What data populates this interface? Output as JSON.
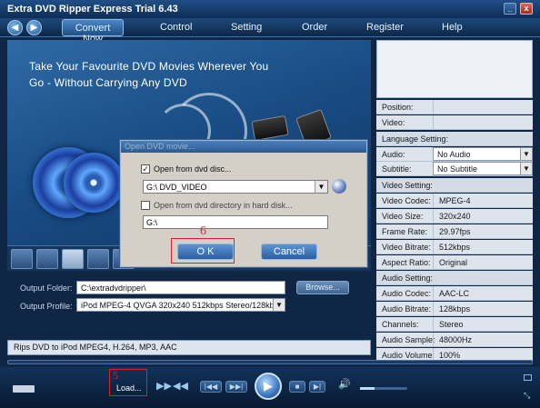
{
  "window": {
    "title": "Extra DVD Ripper Express Trial 6.43",
    "minimize": "_",
    "close": "x"
  },
  "menu": {
    "back": "◀",
    "forward": "▶",
    "items": [
      "Convert Now",
      "Control",
      "Setting",
      "Order",
      "Register",
      "Help"
    ]
  },
  "banner": {
    "line1": "Take Your Favourite DVD Movies Wherever  You",
    "line2": "Go - Without Carrying Any DVD"
  },
  "dialog": {
    "title": "Open DVD movie...",
    "option_disc": {
      "label": "Open from dvd disc...",
      "checked": true,
      "mark": "✓"
    },
    "disc_select": {
      "value": "G:\\ DVD_VIDEO",
      "arrow": "▼"
    },
    "option_dir": {
      "label": "Open from dvd directory in hard disk...",
      "checked": false
    },
    "dir_path": "G:\\",
    "ok_label": "O K",
    "cancel_label": "Cancel",
    "annotation_step": "6"
  },
  "output": {
    "folder_label": "Output Folder:",
    "folder_value": "C:\\extradvdripper\\",
    "browse_label": "Browse...",
    "profile_label": "Output Profile:",
    "profile_value": "iPod  MPEG-4 QVGA 320x240 512kbps  Stereo/128kbps",
    "profile_arrow": "▼"
  },
  "status": {
    "text": "Rips DVD to iPod MPEG4, H.264, MP3, AAC"
  },
  "properties": {
    "rows": [
      {
        "key": "Position:",
        "value": ""
      },
      {
        "key": "Video:",
        "value": ""
      }
    ],
    "language_setting": "Language Setting:",
    "audio": {
      "key": "Audio:",
      "value": "No Audio",
      "arrow": "▼"
    },
    "subtitle": {
      "key": "Subtitle:",
      "value": "No Subtitle",
      "arrow": "▼"
    },
    "video_setting": "Video Setting:",
    "video_rows": [
      {
        "key": "Video Codec:",
        "value": "MPEG-4"
      },
      {
        "key": "Video Size:",
        "value": "320x240"
      },
      {
        "key": "Frame Rate:",
        "value": "29.97fps"
      },
      {
        "key": "Video Bitrate:",
        "value": "512kbps"
      },
      {
        "key": "Aspect Ratio:",
        "value": "Original"
      }
    ],
    "audio_setting": "Audio Setting:",
    "audio_rows": [
      {
        "key": "Audio Codec:",
        "value": "AAC-LC"
      },
      {
        "key": "Audio Bitrate:",
        "value": "128kbps"
      },
      {
        "key": "Channels:",
        "value": "Stereo"
      },
      {
        "key": "Audio Sample:",
        "value": "48000Hz"
      },
      {
        "key": "Audio Volume:",
        "value": "100%"
      }
    ]
  },
  "player": {
    "load_label": "Load...",
    "annotation_step": "5",
    "progress": 0.0,
    "volume": 0.3,
    "play": "▶",
    "rewind": "◀◀",
    "fast_forward": "▶▶",
    "prev_chapter": "|◀◀",
    "next_chapter": "▶▶|",
    "stop": "■",
    "next": "▶|",
    "speaker": "🔊"
  }
}
